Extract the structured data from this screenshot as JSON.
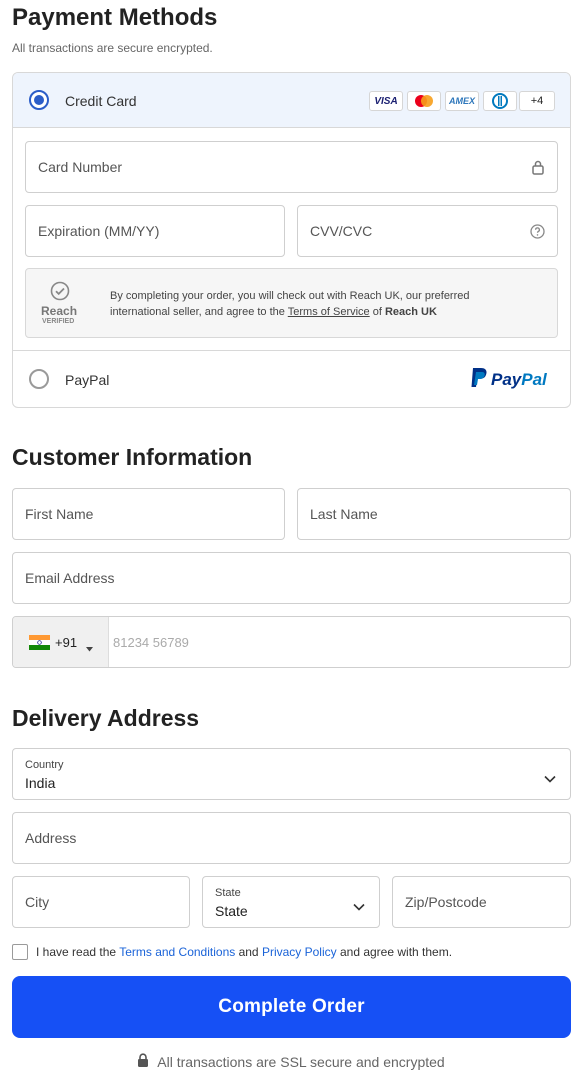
{
  "payment": {
    "title": "Payment Methods",
    "subtitle": "All transactions are secure encrypted.",
    "credit_card_label": "Credit Card",
    "brands": {
      "visa": "VISA",
      "amex": "AMEX",
      "more": "+4"
    },
    "card_number_placeholder": "Card Number",
    "expiration_placeholder": "Expiration (MM/YY)",
    "cvv_placeholder": "CVV/CVC",
    "reach": {
      "logo_word": "Reach",
      "logo_sub": "VERIFIED",
      "text_prefix": "By completing your order, you will check out with Reach UK, our preferred international seller, and agree to the ",
      "tos_link": "Terms of Service",
      "of": " of ",
      "company": "Reach UK"
    },
    "paypal_label": "PayPal",
    "paypal_logo_pay": "Pay",
    "paypal_logo_pal": "Pal"
  },
  "customer": {
    "title": "Customer Information",
    "first_name_placeholder": "First Name",
    "last_name_placeholder": "Last Name",
    "email_placeholder": "Email Address",
    "phone_code": "+91",
    "phone_placeholder": "81234 56789"
  },
  "delivery": {
    "title": "Delivery Address",
    "country_label": "Country",
    "country_value": "India",
    "address_placeholder": "Address",
    "city_placeholder": "City",
    "state_label": "State",
    "state_value": "State",
    "zip_placeholder": "Zip/Postcode"
  },
  "terms": {
    "prefix": "I have read the ",
    "terms_link": "Terms and Conditions",
    "and": " and ",
    "privacy_link": "Privacy Policy",
    "suffix": " and agree with them."
  },
  "cta_label": "Complete Order",
  "footer_text": "All transactions are SSL secure and encrypted",
  "colors": {
    "accent": "#1650f5",
    "radio": "#2b5dc8",
    "link": "#1a63d8"
  }
}
